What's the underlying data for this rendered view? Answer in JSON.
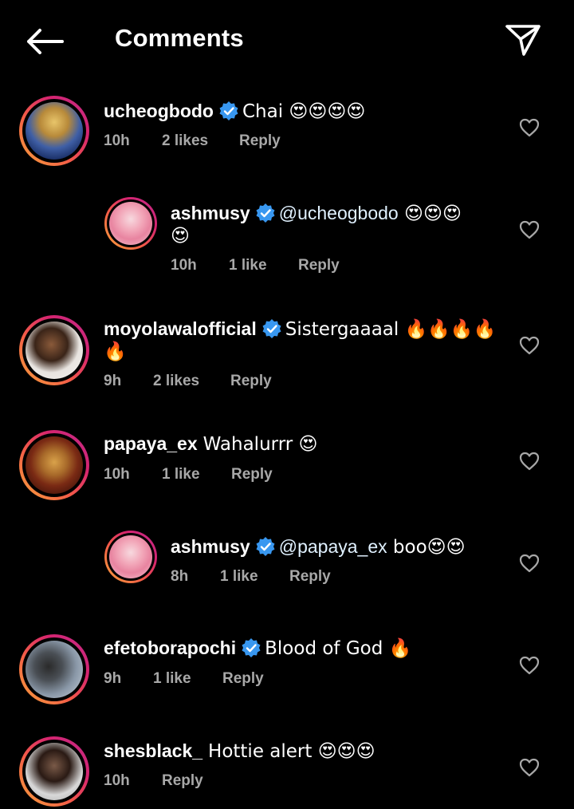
{
  "header": {
    "title": "Comments",
    "back_icon": "arrow-left-icon",
    "share_icon": "paper-plane-icon"
  },
  "colors": {
    "background": "#000000",
    "text": "#ffffff",
    "meta": "#a8a8a8",
    "verified": "#3897f0",
    "ring_start": "#f7a43a",
    "ring_end": "#c02c8a"
  },
  "comments": [
    {
      "username": "ucheogbodo",
      "verified": true,
      "text": "Chai 😍😍😍😍",
      "text_cont": "",
      "time": "10h",
      "likes": "2 likes",
      "reply": "Reply",
      "is_reply": false
    },
    {
      "username": "ashmusy",
      "verified": true,
      "mention": "@ucheogbodo",
      "text": " 😍😍😍",
      "text_cont": "😍",
      "time": "10h",
      "likes": "1 like",
      "reply": "Reply",
      "is_reply": true
    },
    {
      "username": "moyolawalofficial",
      "verified": true,
      "text": "Sistergaaaal 🔥🔥🔥🔥",
      "text_cont": "🔥",
      "time": "9h",
      "likes": "2 likes",
      "reply": "Reply",
      "is_reply": false
    },
    {
      "username": "papaya_ex",
      "verified": false,
      "text": "Wahalurrr 😍",
      "text_cont": "",
      "time": "10h",
      "likes": "1 like",
      "reply": "Reply",
      "is_reply": false
    },
    {
      "username": "ashmusy",
      "verified": true,
      "mention": "@papaya_ex",
      "text": " boo😍😍",
      "text_cont": "",
      "time": "8h",
      "likes": "1 like",
      "reply": "Reply",
      "is_reply": true
    },
    {
      "username": "efetoborapochi",
      "verified": true,
      "text": "Blood of God 🔥",
      "text_cont": "",
      "time": "9h",
      "likes": "1 like",
      "reply": "Reply",
      "is_reply": false
    },
    {
      "username": "shesblack_",
      "verified": false,
      "text": "Hottie alert 😍😍😍",
      "text_cont": "",
      "time": "10h",
      "likes": "",
      "reply": "Reply",
      "is_reply": false
    }
  ]
}
